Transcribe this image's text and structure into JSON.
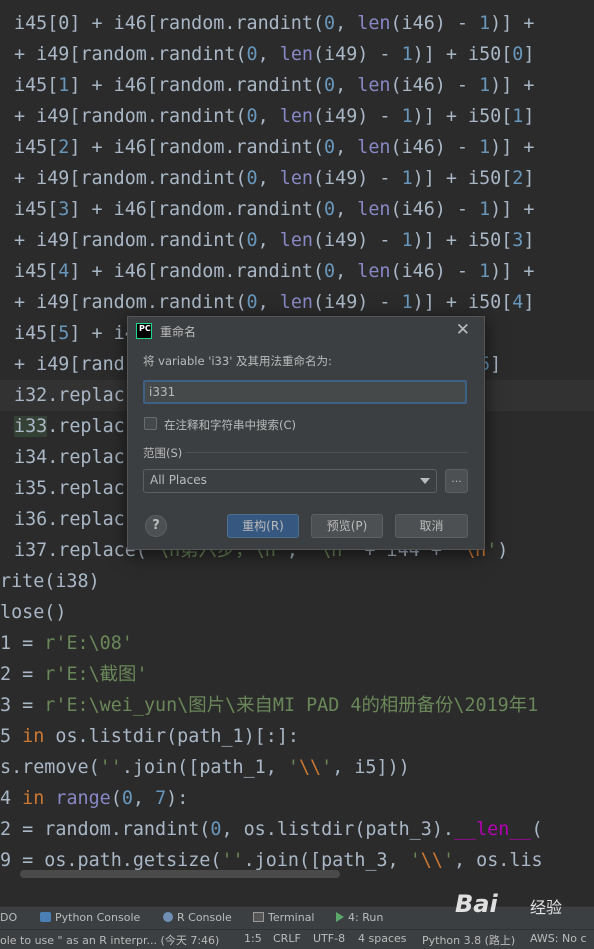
{
  "editor": {
    "lines": [
      {
        "tokens": [
          [
            "n",
            "i45[0] + i46["
          ],
          [
            "n",
            "random.randint("
          ],
          [
            "num",
            "0"
          ],
          [
            "n",
            ", "
          ],
          [
            "bi",
            "len"
          ],
          [
            "n",
            "(i46) - "
          ],
          [
            "num",
            "1"
          ],
          [
            "n",
            ")] + "
          ]
        ]
      },
      {
        "tokens": [
          [
            "n",
            "+ i49["
          ],
          [
            "n",
            "random.randint("
          ],
          [
            "num",
            "0"
          ],
          [
            "n",
            ", "
          ],
          [
            "bi",
            "len"
          ],
          [
            "n",
            "(i49) - "
          ],
          [
            "num",
            "1"
          ],
          [
            "n",
            ")] + i50["
          ],
          [
            "num",
            "0"
          ],
          [
            "n",
            "]"
          ]
        ]
      },
      {
        "tokens": [
          [
            "n",
            "i45["
          ],
          [
            "num",
            "1"
          ],
          [
            "n",
            "] + i46["
          ],
          [
            "n",
            "random.randint("
          ],
          [
            "num",
            "0"
          ],
          [
            "n",
            ", "
          ],
          [
            "bi",
            "len"
          ],
          [
            "n",
            "(i46) - "
          ],
          [
            "num",
            "1"
          ],
          [
            "n",
            ")] +"
          ]
        ]
      },
      {
        "tokens": [
          [
            "n",
            "+ i49["
          ],
          [
            "n",
            "random.randint("
          ],
          [
            "num",
            "0"
          ],
          [
            "n",
            ", "
          ],
          [
            "bi",
            "len"
          ],
          [
            "n",
            "(i49) - "
          ],
          [
            "num",
            "1"
          ],
          [
            "n",
            ")] + i50["
          ],
          [
            "num",
            "1"
          ],
          [
            "n",
            "]"
          ]
        ]
      },
      {
        "tokens": [
          [
            "n",
            "i45["
          ],
          [
            "num",
            "2"
          ],
          [
            "n",
            "] + i46["
          ],
          [
            "n",
            "random.randint("
          ],
          [
            "num",
            "0"
          ],
          [
            "n",
            ", "
          ],
          [
            "bi",
            "len"
          ],
          [
            "n",
            "(i46) - "
          ],
          [
            "num",
            "1"
          ],
          [
            "n",
            ")] +"
          ]
        ]
      },
      {
        "tokens": [
          [
            "n",
            "+ i49["
          ],
          [
            "n",
            "random.randint("
          ],
          [
            "num",
            "0"
          ],
          [
            "n",
            ", "
          ],
          [
            "bi",
            "len"
          ],
          [
            "n",
            "(i49) - "
          ],
          [
            "num",
            "1"
          ],
          [
            "n",
            ")] + i50["
          ],
          [
            "num",
            "2"
          ],
          [
            "n",
            "]"
          ]
        ]
      },
      {
        "tokens": [
          [
            "n",
            "i45["
          ],
          [
            "num",
            "3"
          ],
          [
            "n",
            "] + i46["
          ],
          [
            "n",
            "random.randint("
          ],
          [
            "num",
            "0"
          ],
          [
            "n",
            ", "
          ],
          [
            "bi",
            "len"
          ],
          [
            "n",
            "(i46) - "
          ],
          [
            "num",
            "1"
          ],
          [
            "n",
            ")] +"
          ]
        ]
      },
      {
        "tokens": [
          [
            "n",
            "+ i49["
          ],
          [
            "n",
            "random.randint("
          ],
          [
            "num",
            "0"
          ],
          [
            "n",
            ", "
          ],
          [
            "bi",
            "len"
          ],
          [
            "n",
            "(i49) - "
          ],
          [
            "num",
            "1"
          ],
          [
            "n",
            ")] + i50["
          ],
          [
            "num",
            "3"
          ],
          [
            "n",
            "]"
          ]
        ]
      },
      {
        "tokens": [
          [
            "n",
            "i45["
          ],
          [
            "num",
            "4"
          ],
          [
            "n",
            "] + i46["
          ],
          [
            "n",
            "random.randint("
          ],
          [
            "num",
            "0"
          ],
          [
            "n",
            ", "
          ],
          [
            "bi",
            "len"
          ],
          [
            "n",
            "(i46) - "
          ],
          [
            "num",
            "1"
          ],
          [
            "n",
            ")] +"
          ]
        ]
      },
      {
        "tokens": [
          [
            "n",
            "+ i49["
          ],
          [
            "n",
            "random.randint("
          ],
          [
            "num",
            "0"
          ],
          [
            "n",
            ", "
          ],
          [
            "bi",
            "len"
          ],
          [
            "n",
            "(i49) - "
          ],
          [
            "num",
            "1"
          ],
          [
            "n",
            ")] + i50["
          ],
          [
            "num",
            "4"
          ],
          [
            "n",
            "]"
          ]
        ]
      },
      {
        "tokens": [
          [
            "n",
            "i45["
          ],
          [
            "num",
            "5"
          ],
          [
            "n",
            "] + i4"
          ],
          [
            "n",
            "                    "
          ],
          [
            "num",
            "- 1"
          ],
          [
            "n",
            ")] +"
          ]
        ]
      },
      {
        "tokens": [
          [
            "n",
            "+ i49[rand"
          ],
          [
            "n",
            "                      "
          ],
          [
            "n",
            "    + i50["
          ],
          [
            "num",
            "5"
          ],
          [
            "n",
            "]"
          ]
        ]
      },
      {
        "cur": true,
        "tokens": [
          [
            "n",
            "i32.replac"
          ],
          [
            "n",
            "                      "
          ],
          [
            "str",
            "'"
          ],
          [
            "esc",
            "\\n"
          ],
          [
            "str",
            "'"
          ],
          [
            "n",
            ")"
          ]
        ]
      },
      {
        "tokens": [
          [
            "hl",
            "i33"
          ],
          [
            "n",
            ".replac"
          ],
          [
            "n",
            "                      "
          ],
          [
            "str",
            "'"
          ],
          [
            "esc",
            "\\n"
          ],
          [
            "str",
            "'"
          ],
          [
            "n",
            ")"
          ]
        ]
      },
      {
        "tokens": [
          [
            "n",
            "i34.replac"
          ],
          [
            "n",
            "                      "
          ],
          [
            "str",
            "'"
          ],
          [
            "esc",
            "\\n"
          ],
          [
            "str",
            "'"
          ],
          [
            "n",
            ")"
          ]
        ]
      },
      {
        "tokens": [
          [
            "n",
            "i35.replac"
          ],
          [
            "n",
            "                      "
          ],
          [
            "str",
            "'"
          ],
          [
            "esc",
            "\\n"
          ],
          [
            "str",
            "'"
          ],
          [
            "n",
            ")"
          ]
        ]
      },
      {
        "tokens": [
          [
            "n",
            "i36.replac"
          ],
          [
            "n",
            "                      "
          ],
          [
            "str",
            "'"
          ],
          [
            "esc",
            "\\n"
          ],
          [
            "str",
            "'"
          ],
          [
            "n",
            ")"
          ]
        ]
      },
      {
        "tokens": [
          [
            "n",
            "i37.replace("
          ],
          [
            "str",
            "'\\n第六步，\\n'"
          ],
          [
            "n",
            ", "
          ],
          [
            "str",
            "'\\n'"
          ],
          [
            "n",
            " + i44 + "
          ],
          [
            "str",
            "'"
          ],
          [
            "esc",
            "\\n"
          ],
          [
            "str",
            "'"
          ],
          [
            "n",
            ")"
          ]
        ]
      },
      {
        "tokens": [
          [
            "n",
            "rite(i38)"
          ]
        ]
      },
      {
        "tokens": [
          [
            "n",
            "lose()"
          ]
        ]
      },
      {
        "tokens": [
          [
            "n",
            "1 = "
          ],
          [
            "str",
            "r'E:\\08'"
          ]
        ]
      },
      {
        "tokens": [
          [
            "n",
            "2 = "
          ],
          [
            "str",
            "r'E:\\截图'"
          ]
        ]
      },
      {
        "tokens": [
          [
            "n",
            "3 = "
          ],
          [
            "str",
            "r'E:\\wei_yun\\图片\\来自MI PAD 4的相册备份\\2019年1"
          ]
        ]
      },
      {
        "tokens": [
          [
            "n",
            "5 "
          ],
          [
            "kw",
            "in"
          ],
          [
            "n",
            " os.listdir(path_1)[:]:"
          ]
        ]
      },
      {
        "tokens": [
          [
            "n",
            "s.remove("
          ],
          [
            "str",
            "''"
          ],
          [
            "n",
            ".join([path_1, "
          ],
          [
            "str",
            "'"
          ],
          [
            "esc",
            "\\\\"
          ],
          [
            "str",
            "'"
          ],
          [
            "n",
            ", i5]))"
          ]
        ]
      },
      {
        "tokens": [
          [
            "n",
            "4 "
          ],
          [
            "kw",
            "in"
          ],
          [
            "n",
            " "
          ],
          [
            "bi",
            "range"
          ],
          [
            "n",
            "("
          ],
          [
            "num",
            "0"
          ],
          [
            "n",
            ", "
          ],
          [
            "num",
            "7"
          ],
          [
            "n",
            "):"
          ]
        ]
      },
      {
        "tokens": [
          [
            "n",
            "2 = random.randint("
          ],
          [
            "num",
            "0"
          ],
          [
            "n",
            ", os.listdir(path_3)."
          ],
          [
            "dun",
            "__len__"
          ],
          [
            "n",
            "("
          ]
        ]
      },
      {
        "tokens": [
          [
            "n",
            "9 = os.path.getsize("
          ],
          [
            "str",
            "''"
          ],
          [
            "n",
            ".join([path_3, "
          ],
          [
            "str",
            "'"
          ],
          [
            "esc",
            "\\\\"
          ],
          [
            "str",
            "'"
          ],
          [
            "n",
            ", os.lis"
          ]
        ]
      }
    ]
  },
  "toolwindows": {
    "todo": "DO",
    "python_console": "Python Console",
    "r_console": "R Console",
    "terminal": "Terminal",
    "run": "4: Run"
  },
  "statusbar": {
    "message": "ole to use \" as an R interpr... (今天 7:46)",
    "position": "1:5",
    "line_sep": "CRLF",
    "encoding": "UTF-8",
    "indent": "4 spaces",
    "interpreter": "Python 3.8 (路上)",
    "aws": "AWS: No c"
  },
  "dialog": {
    "title": "重命名",
    "prompt": "将 variable 'i33' 及其用法重命名为:",
    "input_value": "i331",
    "checkbox_label": "在注释和字符串中搜索(C)",
    "checkbox_checked": false,
    "scope_label": "范围(S)",
    "scope_value": "All Places",
    "more_label": "...",
    "help_label": "?",
    "ok_label": "重构(R)",
    "preview_label": "预览(P)",
    "cancel_label": "取消"
  },
  "watermark": {
    "brand": "Bai",
    "sub": "经验"
  }
}
